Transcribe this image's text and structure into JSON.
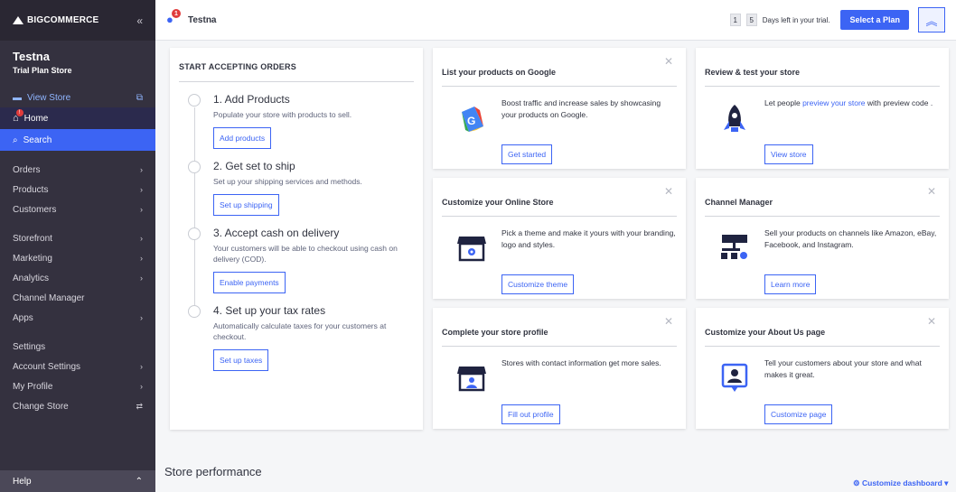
{
  "sidebar": {
    "brand": "BIGCOMMERCE",
    "collapse": "«",
    "store_name": "Testna",
    "store_plan": "Trial Plan Store",
    "view_store": "View Store",
    "home": "Home",
    "home_badge": "!",
    "search": "Search",
    "group1": [
      "Orders",
      "Products",
      "Customers"
    ],
    "group2": [
      "Storefront",
      "Marketing",
      "Analytics",
      "Channel Manager",
      "Apps"
    ],
    "group3": [
      "Settings",
      "Account Settings",
      "My Profile",
      "Change Store"
    ],
    "help": "Help"
  },
  "topbar": {
    "store_name": "Testna",
    "notification_count": "1",
    "trial_digit_1": "1",
    "trial_digit_2": "5",
    "trial_text": "Days left in your trial.",
    "select_plan": "Select a Plan"
  },
  "orders": {
    "title": "START ACCEPTING ORDERS",
    "steps": [
      {
        "title": "1. Add Products",
        "desc": "Populate your store with products to sell.",
        "button": "Add products"
      },
      {
        "title": "2. Get set to ship",
        "desc": "Set up your shipping services and methods.",
        "button": "Set up shipping"
      },
      {
        "title": "3. Accept cash on delivery",
        "desc": "Your customers will be able to checkout using cash on delivery (COD).",
        "button": "Enable payments"
      },
      {
        "title": "4. Set up your tax rates",
        "desc": "Automatically calculate taxes for your customers at checkout.",
        "button": "Set up taxes"
      }
    ]
  },
  "cards": {
    "google": {
      "title": "List your products on Google",
      "text": "Boost traffic and increase sales by showcasing your products on Google.",
      "button": "Get started"
    },
    "review": {
      "title": "Review & test your store",
      "text_before": "Let people ",
      "link": "preview your store",
      "text_after": " with preview code .",
      "button": "View store"
    },
    "customize": {
      "title": "Customize your Online Store",
      "text": "Pick a theme and make it yours with your branding, logo and styles.",
      "button": "Customize theme"
    },
    "channel": {
      "title": "Channel Manager",
      "text": "Sell your products on channels like Amazon, eBay, Facebook, and Instagram.",
      "button": "Learn more"
    },
    "profile": {
      "title": "Complete your store profile",
      "text": "Stores with contact information get more sales.",
      "button": "Fill out profile"
    },
    "about": {
      "title": "Customize your About Us page",
      "text": "Tell your customers about your store and what makes it great.",
      "button": "Customize page"
    }
  },
  "footer": {
    "store_performance": "Store performance",
    "customize_dashboard": "Customize dashboard"
  },
  "colors": {
    "accent": "#3c64f4",
    "sidebar": "#34313f",
    "search_highlight": "#3c64f4"
  }
}
